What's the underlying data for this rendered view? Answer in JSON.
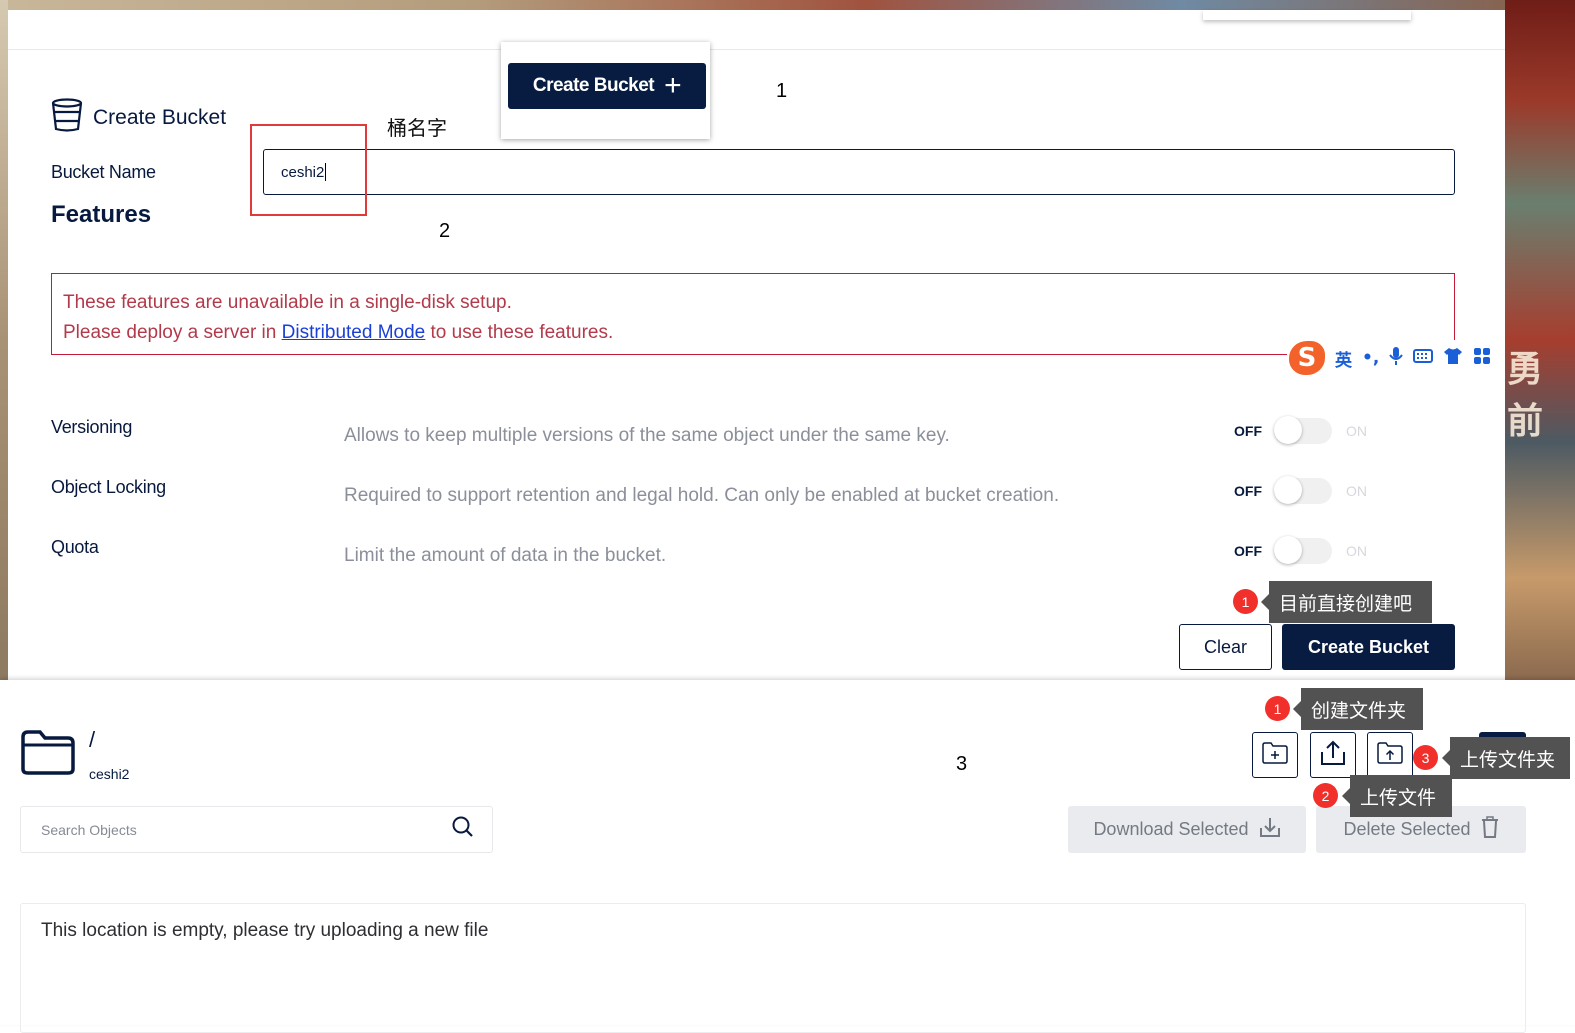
{
  "popup": {
    "button_label": "Create Bucket",
    "plus_glyph": "+"
  },
  "annotations": {
    "n1": "1",
    "n2": "2",
    "n3": "3",
    "bucket_name_cn": "桶名字"
  },
  "create_bucket": {
    "title": "Create Bucket",
    "bucket_name_label": "Bucket Name",
    "bucket_name_value": "ceshi2",
    "features_title": "Features",
    "warning_line1": "These features are unavailable in a single-disk setup.",
    "warning_line2_pre": "Please deploy a server in ",
    "warning_link": "Distributed Mode",
    "warning_line2_post": " to use these features.",
    "features": [
      {
        "label": "Versioning",
        "description": "Allows to keep multiple versions of the same object under the same key.",
        "off": "OFF",
        "on": "ON",
        "enabled": false
      },
      {
        "label": "Object Locking",
        "description": "Required to support retention and legal hold. Can only be enabled at bucket creation.",
        "off": "OFF",
        "on": "ON",
        "enabled": false
      },
      {
        "label": "Quota",
        "description": "Limit the amount of data in the bucket.",
        "off": "OFF",
        "on": "ON",
        "enabled": false
      }
    ],
    "clear_label": "Clear",
    "create_label": "Create Bucket"
  },
  "tooltips": {
    "create_now": {
      "badge": "1",
      "text": "目前直接创建吧"
    },
    "create_folder": {
      "badge": "1",
      "text": "创建文件夹"
    },
    "upload_file": {
      "badge": "2",
      "text": "上传文件"
    },
    "upload_folder": {
      "badge": "3",
      "text": "上传文件夹"
    }
  },
  "ime_toolbar": {
    "logo": "S",
    "items": [
      "英",
      "•,",
      "mic-icon",
      "keyboard-icon",
      "shirt-icon",
      "grid-icon"
    ],
    "labels": {
      "lang": "英",
      "punct": "•,"
    }
  },
  "background": {
    "banner_text": "勇前"
  },
  "browser": {
    "path": "/",
    "bucket": "ceshi2",
    "search_placeholder": "Search Objects",
    "download_selected": "Download Selected",
    "delete_selected": "Delete Selected",
    "empty_message": "This location is empty, please try uploading a new file"
  },
  "colors": {
    "navy": "#081c42",
    "warning": "#c51b3a",
    "badge": "#f2302b"
  }
}
